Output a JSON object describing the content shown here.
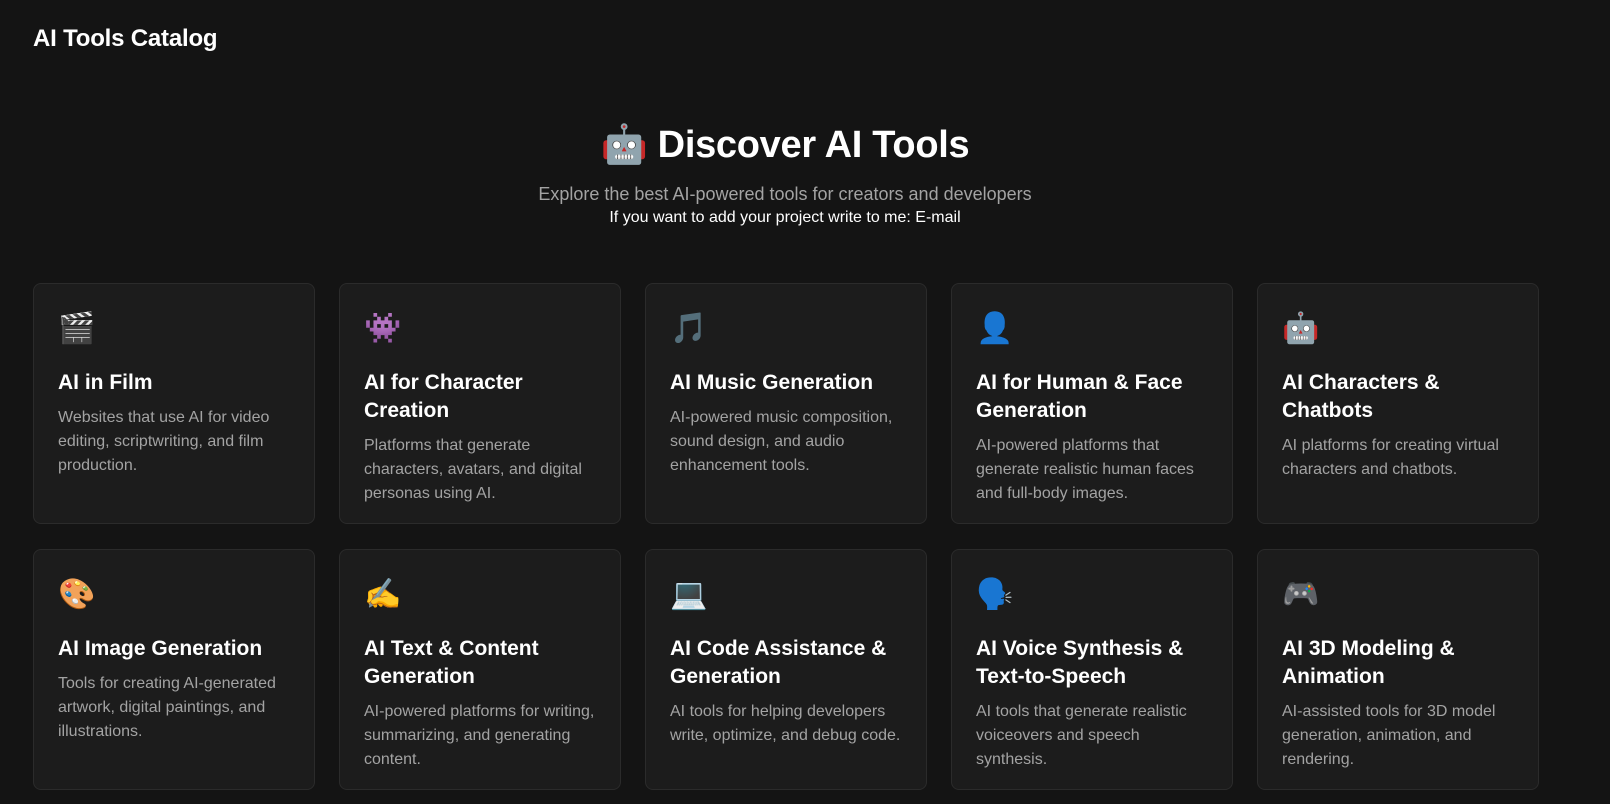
{
  "header": {
    "brand": "AI Tools Catalog"
  },
  "hero": {
    "emoji": "🤖",
    "title": "Discover AI Tools",
    "subtitle": "Explore the best AI-powered tools for creators and developers",
    "note": "If you want to add your project write to me: E-mail"
  },
  "categories": [
    {
      "icon": "🎬",
      "icon_name": "clapperboard-icon",
      "title": "AI in Film",
      "description": "Websites that use AI for video editing, scriptwriting, and film production."
    },
    {
      "icon": "👾",
      "icon_name": "alien-monster-icon",
      "title": "AI for Character Creation",
      "description": "Platforms that generate characters, avatars, and digital personas using AI."
    },
    {
      "icon": "🎵",
      "icon_name": "music-note-icon",
      "title": "AI Music Generation",
      "description": "AI-powered music composition, sound design, and audio enhancement tools."
    },
    {
      "icon": "👤",
      "icon_name": "person-silhouette-icon",
      "title": "AI for Human & Face Generation",
      "description": "AI-powered platforms that generate realistic human faces and full-body images."
    },
    {
      "icon": "🤖",
      "icon_name": "robot-icon",
      "title": "AI Characters & Chatbots",
      "description": "AI platforms for creating virtual characters and chatbots."
    },
    {
      "icon": "🎨",
      "icon_name": "palette-icon",
      "title": "AI Image Generation",
      "description": "Tools for creating AI-generated artwork, digital paintings, and illustrations."
    },
    {
      "icon": "✍️",
      "icon_name": "writing-hand-icon",
      "title": "AI Text & Content Generation",
      "description": "AI-powered platforms for writing, summarizing, and generating content."
    },
    {
      "icon": "💻",
      "icon_name": "laptop-icon",
      "title": "AI Code Assistance & Generation",
      "description": "AI tools for helping developers write, optimize, and debug code."
    },
    {
      "icon": "🗣️",
      "icon_name": "speaking-head-icon",
      "title": "AI Voice Synthesis & Text-to-Speech",
      "description": "AI tools that generate realistic voiceovers and speech synthesis."
    },
    {
      "icon": "🎮",
      "icon_name": "game-controller-icon",
      "title": "AI 3D Modeling & Animation",
      "description": "AI-assisted tools for 3D model generation, animation, and rendering."
    }
  ]
}
